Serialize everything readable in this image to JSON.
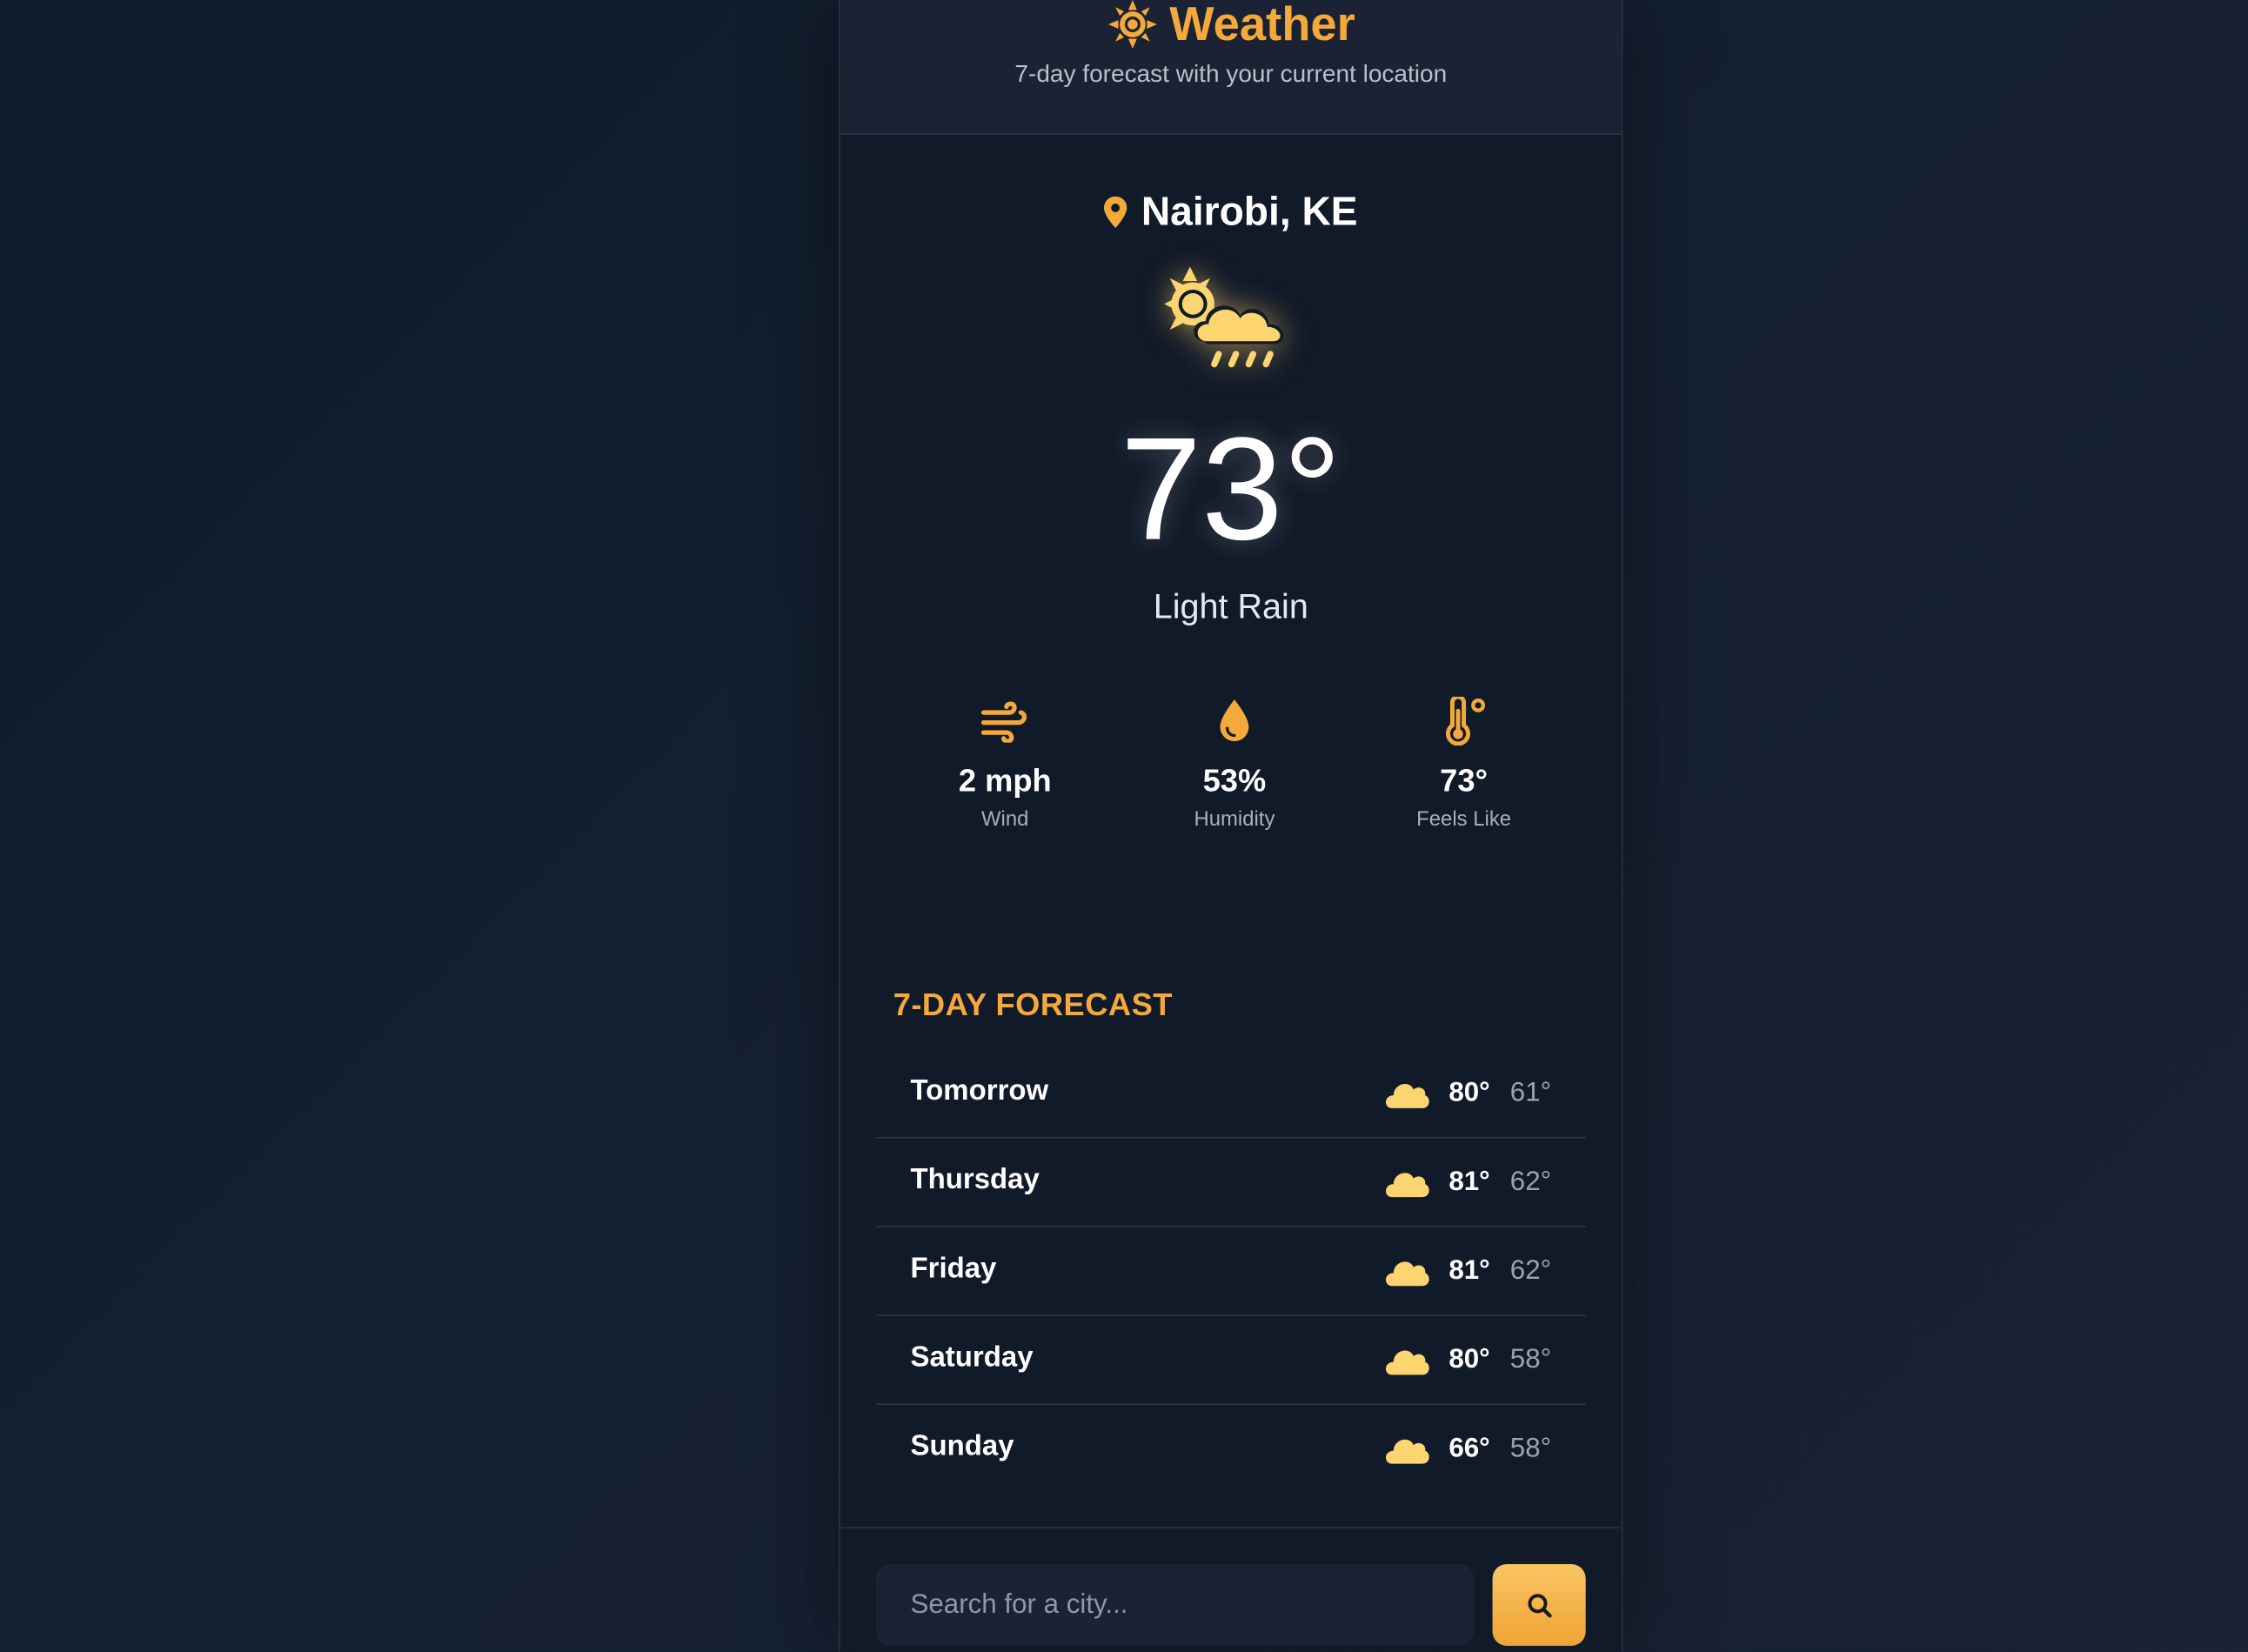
{
  "header": {
    "title": "Weather",
    "subtitle": "7-day forecast with your current location"
  },
  "current": {
    "location": "Nairobi, KE",
    "temperature": "73°",
    "condition": "Light Rain",
    "condition_icon": "sun-cloud-rain-icon"
  },
  "stats": [
    {
      "value": "2 mph",
      "label": "Wind",
      "icon": "wind-icon"
    },
    {
      "value": "53%",
      "label": "Humidity",
      "icon": "droplet-icon"
    },
    {
      "value": "73°",
      "label": "Feels Like",
      "icon": "thermometer-icon"
    }
  ],
  "forecast": {
    "heading": "7-DAY FORECAST",
    "days": [
      {
        "day": "Tomorrow",
        "high": "80°",
        "low": "61°",
        "icon": "cloud-icon"
      },
      {
        "day": "Thursday",
        "high": "81°",
        "low": "62°",
        "icon": "cloud-icon"
      },
      {
        "day": "Friday",
        "high": "81°",
        "low": "62°",
        "icon": "cloud-icon"
      },
      {
        "day": "Saturday",
        "high": "80°",
        "low": "58°",
        "icon": "cloud-icon"
      },
      {
        "day": "Sunday",
        "high": "66°",
        "low": "58°",
        "icon": "cloud-icon"
      }
    ]
  },
  "search": {
    "placeholder": "Search for a city...",
    "value": ""
  },
  "colors": {
    "accent": "#f4a93b",
    "icon_yellow": "#fcd571",
    "background": "#111a29",
    "header_bg": "#1a2234"
  }
}
